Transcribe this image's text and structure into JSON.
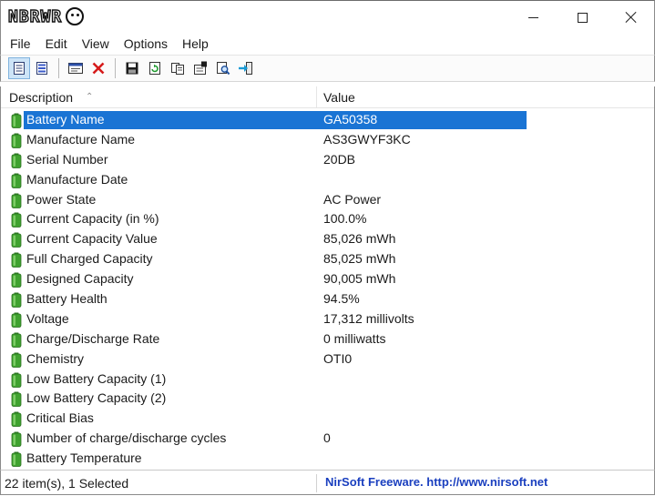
{
  "window": {
    "logo_text": "NBRWR",
    "minimize_label": "",
    "maximize_label": "",
    "close_label": ""
  },
  "menu": [
    "File",
    "Edit",
    "View",
    "Options",
    "Help"
  ],
  "toolbar": {
    "buttons": [
      "html-report-icon",
      "html-report-all-icon",
      "properties-icon",
      "delete-icon",
      "save-icon",
      "refresh-icon",
      "copy-icon",
      "options-icon",
      "find-icon",
      "exit-icon"
    ]
  },
  "list": {
    "columns": {
      "description": "Description",
      "value": "Value"
    },
    "rows": [
      {
        "description": "Battery Name",
        "value": "GA50358",
        "selected": true
      },
      {
        "description": "Manufacture Name",
        "value": "AS3GWYF3KC"
      },
      {
        "description": "Serial Number",
        "value": "20DB"
      },
      {
        "description": "Manufacture Date",
        "value": ""
      },
      {
        "description": "Power State",
        "value": "AC Power"
      },
      {
        "description": "Current Capacity (in %)",
        "value": "100.0%"
      },
      {
        "description": "Current Capacity Value",
        "value": "85,026 mWh"
      },
      {
        "description": "Full Charged Capacity",
        "value": "85,025 mWh"
      },
      {
        "description": "Designed Capacity",
        "value": "90,005 mWh"
      },
      {
        "description": "Battery Health",
        "value": "94.5%"
      },
      {
        "description": "Voltage",
        "value": "17,312 millivolts"
      },
      {
        "description": "Charge/Discharge Rate",
        "value": "0 milliwatts"
      },
      {
        "description": "Chemistry",
        "value": "OTI0"
      },
      {
        "description": "Low Battery Capacity (1)",
        "value": ""
      },
      {
        "description": "Low Battery Capacity (2)",
        "value": ""
      },
      {
        "description": "Critical Bias",
        "value": ""
      },
      {
        "description": "Number of charge/discharge cycles",
        "value": "0"
      },
      {
        "description": "Battery Temperature",
        "value": ""
      }
    ]
  },
  "status": {
    "count": "22 item(s), 1 Selected",
    "link": "NirSoft Freeware.  http://www.nirsoft.net"
  },
  "colors": {
    "selection": "#1a74d4",
    "battery_green": "#3fa22f",
    "link_blue": "#1a3fbf"
  }
}
